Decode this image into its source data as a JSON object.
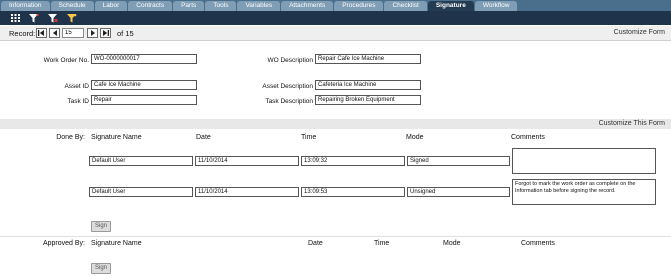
{
  "tabs": [
    "Information",
    "Schedule",
    "Labor",
    "Contracts",
    "Parts",
    "Tools",
    "Variables",
    "Attachments",
    "Procedures",
    "Checklist",
    "Signature",
    "Workflow"
  ],
  "active_tab": "Signature",
  "toolbar": {
    "icons": [
      "grid-icon",
      "filter-icon",
      "filter-clear-icon",
      "filter-saved-icon"
    ]
  },
  "record": {
    "label": "Record:",
    "value": "15",
    "of_text": "of 15"
  },
  "customize_form": "Customize Form",
  "form": {
    "work_order_no_label": "Work Order No.",
    "work_order_no": "WO-0000000017",
    "wo_description_label": "WO Description",
    "wo_description": "Repair Cafe Ice Machine",
    "asset_id_label": "Asset ID",
    "asset_id": "Cafe Ice Machine",
    "asset_description_label": "Asset Description",
    "asset_description": "Cafeteria Ice Machine",
    "task_id_label": "Task ID",
    "task_id": "Repair",
    "task_description_label": "Task Description",
    "task_description": "Repairing Broken Equipment"
  },
  "customize_this_form": "Customize This Form",
  "done_by": {
    "label": "Done By:",
    "columns": [
      "Signature Name",
      "Date",
      "Time",
      "Mode",
      "Comments"
    ],
    "rows": [
      {
        "name": "Default User",
        "date": "11/10/2014",
        "time": "13:09:32",
        "mode": "Signed",
        "comments": ""
      },
      {
        "name": "Default User",
        "date": "11/10/2014",
        "time": "13:09:53",
        "mode": "Unsigned",
        "comments": "Forgot to mark the work order as complete on the Information tab before signing the record."
      }
    ],
    "sign_label": "Sign"
  },
  "approved_by": {
    "label": "Approved By:",
    "columns": [
      "Signature Name",
      "Date",
      "Time",
      "Mode",
      "Comments"
    ],
    "sign_label": "Sign"
  }
}
